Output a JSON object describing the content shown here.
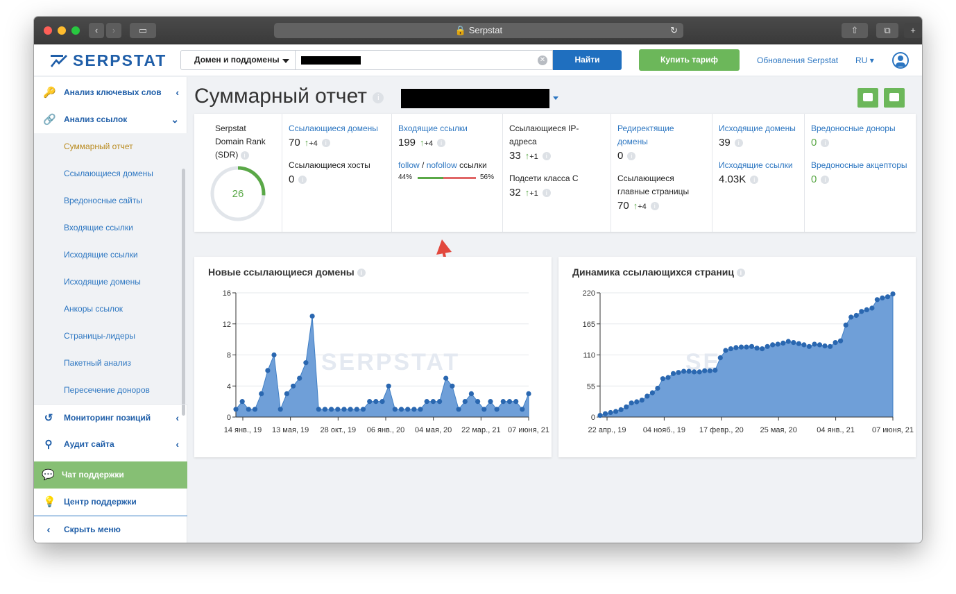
{
  "browser": {
    "title": "Serpstat"
  },
  "header": {
    "logo": "SERPSTAT",
    "search_mode": "Домен и поддомены",
    "find_label": "Найти",
    "buy_label": "Купить тариф",
    "updates_label": "Обновления Serpstat",
    "lang": "RU"
  },
  "sidebar": {
    "keyword_analysis": "Анализ ключевых слов",
    "link_analysis": "Анализ ссылок",
    "subitems": [
      "Суммарный отчет",
      "Ссылающиеся домены",
      "Вредоносные сайты",
      "Входящие ссылки",
      "Исходящие ссылки",
      "Исходящие домены",
      "Анкоры ссылок",
      "Страницы-лидеры",
      "Пакетный анализ",
      "Пересечение доноров"
    ],
    "position_monitoring": "Мониторинг позиций",
    "site_audit": "Аудит сайта",
    "support_chat": "Чат поддержки",
    "support_center": "Центр поддержки",
    "hide_menu": "Скрыть меню"
  },
  "page": {
    "title": "Суммарный отчет"
  },
  "metrics": {
    "sdr_label": "Serpstat Domain Rank (SDR)",
    "sdr_value": "26",
    "sdr_fraction": 0.26,
    "ref_domains_label": "Ссылающиеся домены",
    "ref_domains_value": "70",
    "ref_domains_delta": "+4",
    "ref_hosts_label": "Ссылающиеся хосты",
    "ref_hosts_value": "0",
    "backlinks_label": "Входящие ссылки",
    "backlinks_value": "199",
    "backlinks_delta": "+4",
    "follow_label": "follow",
    "slash": " / ",
    "nofollow_label": "nofollow",
    "links_word": " ссылки",
    "follow_pct": "44%",
    "nofollow_pct": "56%",
    "follow_fraction": 0.44,
    "ip_label": "Ссылающиеся IP-адреса",
    "ip_value": "33",
    "ip_delta": "+1",
    "subnet_label": "Подсети класса C",
    "subnet_value": "32",
    "subnet_delta": "+1",
    "redirect_label": "Редиректящие домены",
    "redirect_value": "0",
    "main_pages_label": "Ссылающиеся главные страницы",
    "main_pages_value": "70",
    "main_pages_delta": "+4",
    "out_domains_label": "Исходящие домены",
    "out_domains_value": "39",
    "out_links_label": "Исходящие ссылки",
    "out_links_value": "4.03K",
    "bad_donors_label": "Вредоносные доноры",
    "bad_donors_value": "0",
    "bad_acceptors_label": "Вредоносные акцепторы",
    "bad_acceptors_value": "0"
  },
  "chart_data": [
    {
      "type": "area",
      "title": "Новые ссылающиеся домены",
      "watermark": "SERPSTAT",
      "ylim": [
        0,
        16
      ],
      "yticks": [
        0,
        4,
        8,
        12,
        16
      ],
      "xtick_labels": [
        "14 янв., 19",
        "13 мая, 19",
        "28 окт., 19",
        "06 янв., 20",
        "04 мая, 20",
        "22 мар., 21",
        "07 июня, 21"
      ],
      "values": [
        1,
        2,
        1,
        1,
        3,
        6,
        8,
        1,
        3,
        4,
        5,
        7,
        13,
        1,
        1,
        1,
        1,
        1,
        1,
        1,
        1,
        2,
        2,
        2,
        4,
        1,
        1,
        1,
        1,
        1,
        2,
        2,
        2,
        5,
        4,
        1,
        2,
        3,
        2,
        1,
        2,
        1,
        2,
        2,
        2,
        1,
        3
      ]
    },
    {
      "type": "area",
      "title": "Динамика ссылающихся страниц",
      "watermark": "SERPSTAT",
      "ylim": [
        0,
        220
      ],
      "yticks": [
        0,
        55,
        110,
        165,
        220
      ],
      "xtick_labels": [
        "22 апр., 19",
        "04 нояб., 19",
        "17 февр., 20",
        "25 мая, 20",
        "04 янв., 21",
        "07 июня, 21"
      ],
      "values": [
        3,
        6,
        8,
        10,
        13,
        18,
        25,
        27,
        30,
        37,
        43,
        51,
        68,
        70,
        77,
        79,
        81,
        81,
        80,
        80,
        82,
        82,
        83,
        105,
        118,
        121,
        123,
        124,
        124,
        125,
        122,
        121,
        125,
        128,
        129,
        131,
        134,
        132,
        130,
        128,
        125,
        129,
        128,
        126,
        125,
        132,
        135,
        163,
        177,
        180,
        187,
        190,
        193,
        208,
        211,
        213,
        218
      ]
    }
  ]
}
